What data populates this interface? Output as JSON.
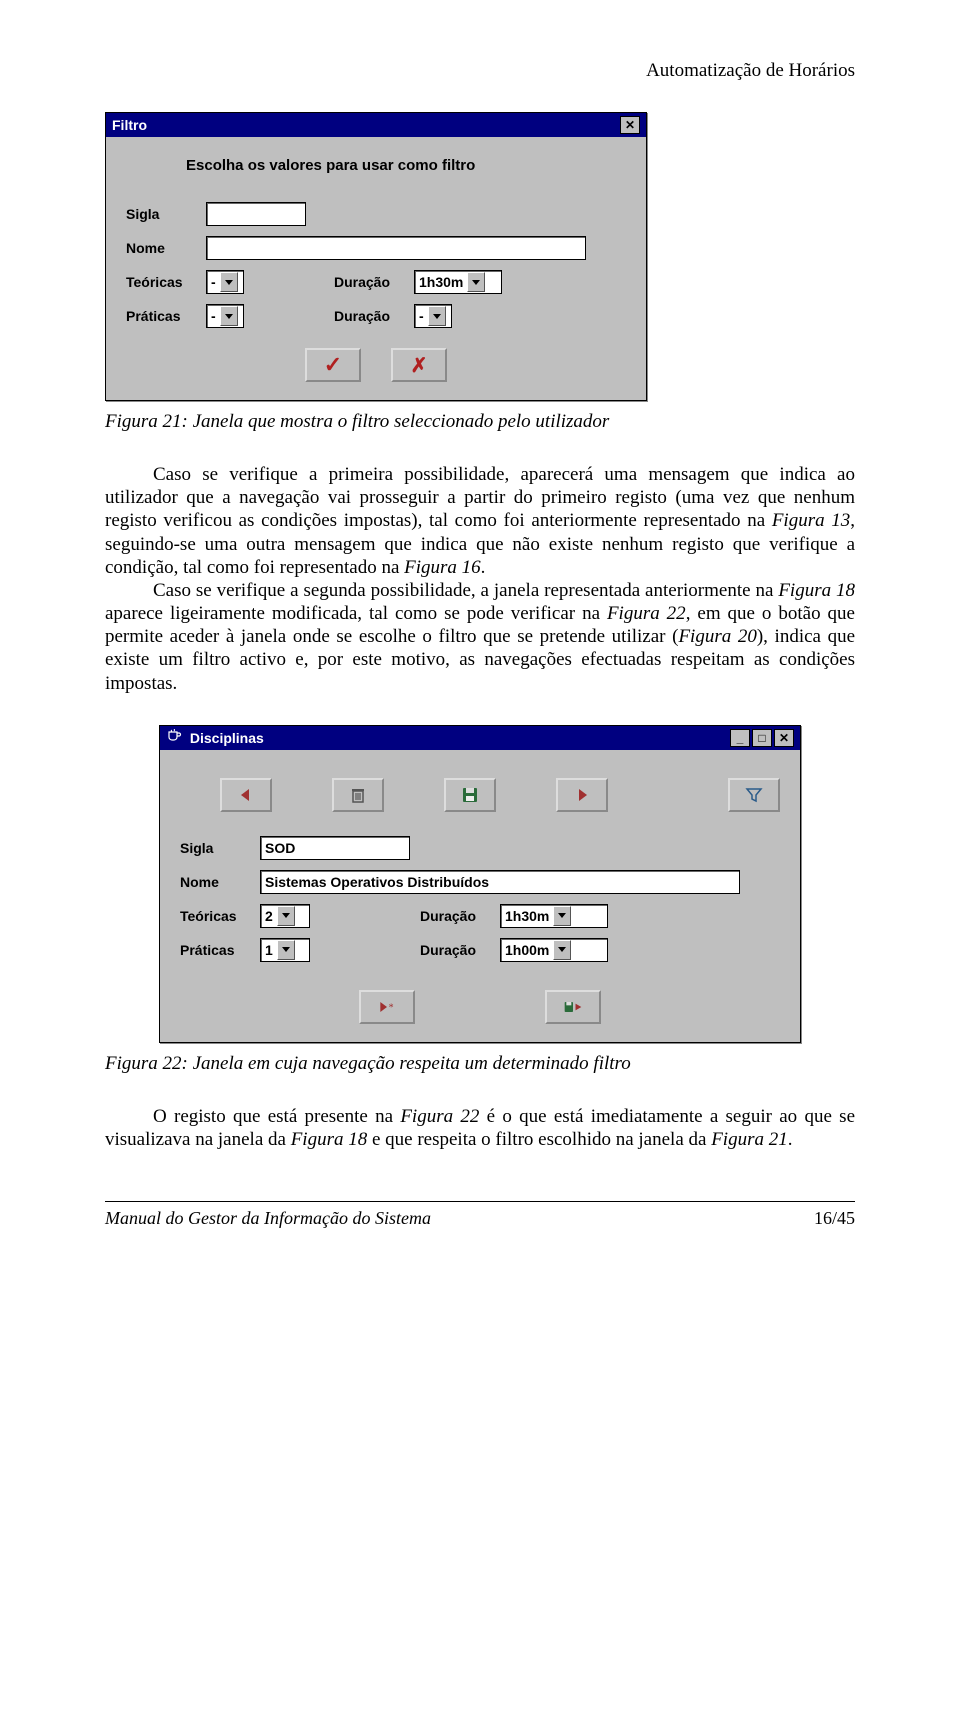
{
  "header": {
    "title": "Automatização de Horários"
  },
  "dialog_filtro": {
    "title": "Filtro",
    "instruction": "Escolha os valores para usar como filtro",
    "labels": {
      "sigla": "Sigla",
      "nome": "Nome",
      "teoricas": "Teóricas",
      "praticas": "Práticas",
      "duracao": "Duração"
    },
    "values": {
      "sigla": "",
      "nome": "",
      "teoricas": "-",
      "duracao_teoricas": "1h30m",
      "praticas": "-",
      "duracao_praticas": "-"
    }
  },
  "caption1": "Figura 21: Janela que mostra o filtro seleccionado pelo utilizador",
  "paragraph1_a": "Caso se verifique a primeira possibilidade, aparecerá uma mensagem que indica ao utilizador que a navegação vai prosseguir a partir do primeiro registo (uma vez que nenhum registo verificou as condições impostas), tal como foi anteriormente representado na ",
  "paragraph1_b": "Figura 13",
  "paragraph1_c": ", seguindo-se uma outra mensagem que indica que não existe nenhum registo que verifique a condição, tal como foi representado na ",
  "paragraph1_d": "Figura 16",
  "paragraph1_e": ".",
  "paragraph2_a": "Caso se verifique a segunda possibilidade, a janela representada anteriormente na ",
  "paragraph2_b": "Figura 18",
  "paragraph2_c": " aparece ligeiramente modificada, tal como se pode verificar na ",
  "paragraph2_d": "Figura 22",
  "paragraph2_e": ", em que o botão que permite aceder à janela onde se escolhe o filtro que se pretende utilizar (",
  "paragraph2_f": "Figura 20",
  "paragraph2_g": "), indica que existe um filtro activo e, por este motivo, as navegações efectuadas respeitam as condições impostas.",
  "dialog_disciplinas": {
    "title": "Disciplinas",
    "labels": {
      "sigla": "Sigla",
      "nome": "Nome",
      "teoricas": "Teóricas",
      "praticas": "Práticas",
      "duracao": "Duração"
    },
    "values": {
      "sigla": "SOD",
      "nome": "Sistemas Operativos Distribuídos",
      "teoricas": "2",
      "duracao_teoricas": "1h30m",
      "praticas": "1",
      "duracao_praticas": "1h00m"
    }
  },
  "caption2": "Figura 22: Janela em cuja navegação respeita um determinado filtro",
  "paragraph3_a": "O registo que está presente na ",
  "paragraph3_b": "Figura 22",
  "paragraph3_c": " é o que está imediatamente a seguir ao que se visualizava na janela da ",
  "paragraph3_d": "Figura 18",
  "paragraph3_e": " e que respeita o filtro escolhido na janela da ",
  "paragraph3_f": "Figura 21",
  "paragraph3_g": ".",
  "footer": {
    "left": "Manual do Gestor da Informação do Sistema",
    "right": "16/45"
  }
}
